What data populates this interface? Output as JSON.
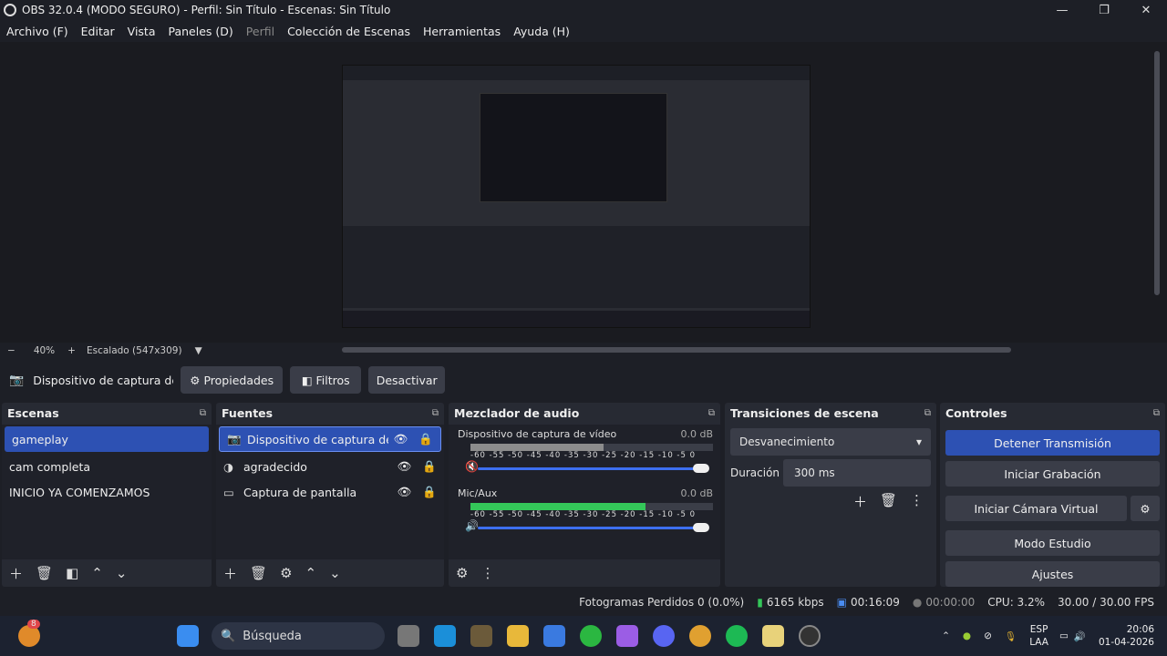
{
  "window": {
    "title": "OBS 32.0.4 (MODO SEGURO) - Perfil: Sin Título - Escenas: Sin Título",
    "minimize": "—",
    "maximize": "❐",
    "close": "✕"
  },
  "menu": [
    "Archivo (F)",
    "Editar",
    "Vista",
    "Paneles (D)",
    "Perfil",
    "Colección de Escenas",
    "Herramientas",
    "Ayuda (H)"
  ],
  "zoom": {
    "minus": "−",
    "level": "40%",
    "plus": "+",
    "scaled": "Escalado (547x309)",
    "dropdown": "▼"
  },
  "source_toolbar": {
    "selected": "Dispositivo de captura de v",
    "properties": "Propiedades",
    "filters": "Filtros",
    "deactivate": "Desactivar"
  },
  "scenes": {
    "title": "Escenas",
    "items": [
      "gameplay",
      "cam completa",
      "INICIO YA COMENZAMOS"
    ]
  },
  "sources": {
    "title": "Fuentes",
    "items": [
      "Dispositivo de captura de vídeo",
      "agradecido",
      "Captura de pantalla"
    ]
  },
  "mixer": {
    "title": "Mezclador de audio",
    "channels": [
      {
        "name": "Dispositivo de captura de vídeo",
        "db": "0.0 dB",
        "level": 0.55,
        "muted": true
      },
      {
        "name": "Mic/Aux",
        "db": "0.0 dB",
        "level": 0.72,
        "muted": false
      }
    ],
    "scale": "-60 -55 -50 -45 -40 -35 -30 -25 -20 -15 -10 -5 0"
  },
  "transitions": {
    "title": "Transiciones de escena",
    "selected": "Desvanecimiento",
    "duration_label": "Duración",
    "duration": "300 ms"
  },
  "controls": {
    "title": "Controles",
    "buttons": [
      "Detener Transmisión",
      "Iniciar Grabación",
      "Iniciar Cámara Virtual",
      "Modo Estudio",
      "Ajustes"
    ]
  },
  "status": {
    "dropped": "Fotogramas Perdidos 0 (0.0%)",
    "bitrate": "6165 kbps",
    "stream_time": "00:16:09",
    "rec_time": "00:00:00",
    "cpu": "CPU: 3.2%",
    "fps": "30.00 / 30.00 FPS"
  },
  "taskbar": {
    "search": "Búsqueda",
    "lang": "ESP",
    "lang2": "LAA",
    "time": "20:06",
    "date": "01-04-2026",
    "badge": "8"
  },
  "colors": {
    "accent": "#2d51b3",
    "panel": "#272a33",
    "background": "#1d1f26"
  }
}
